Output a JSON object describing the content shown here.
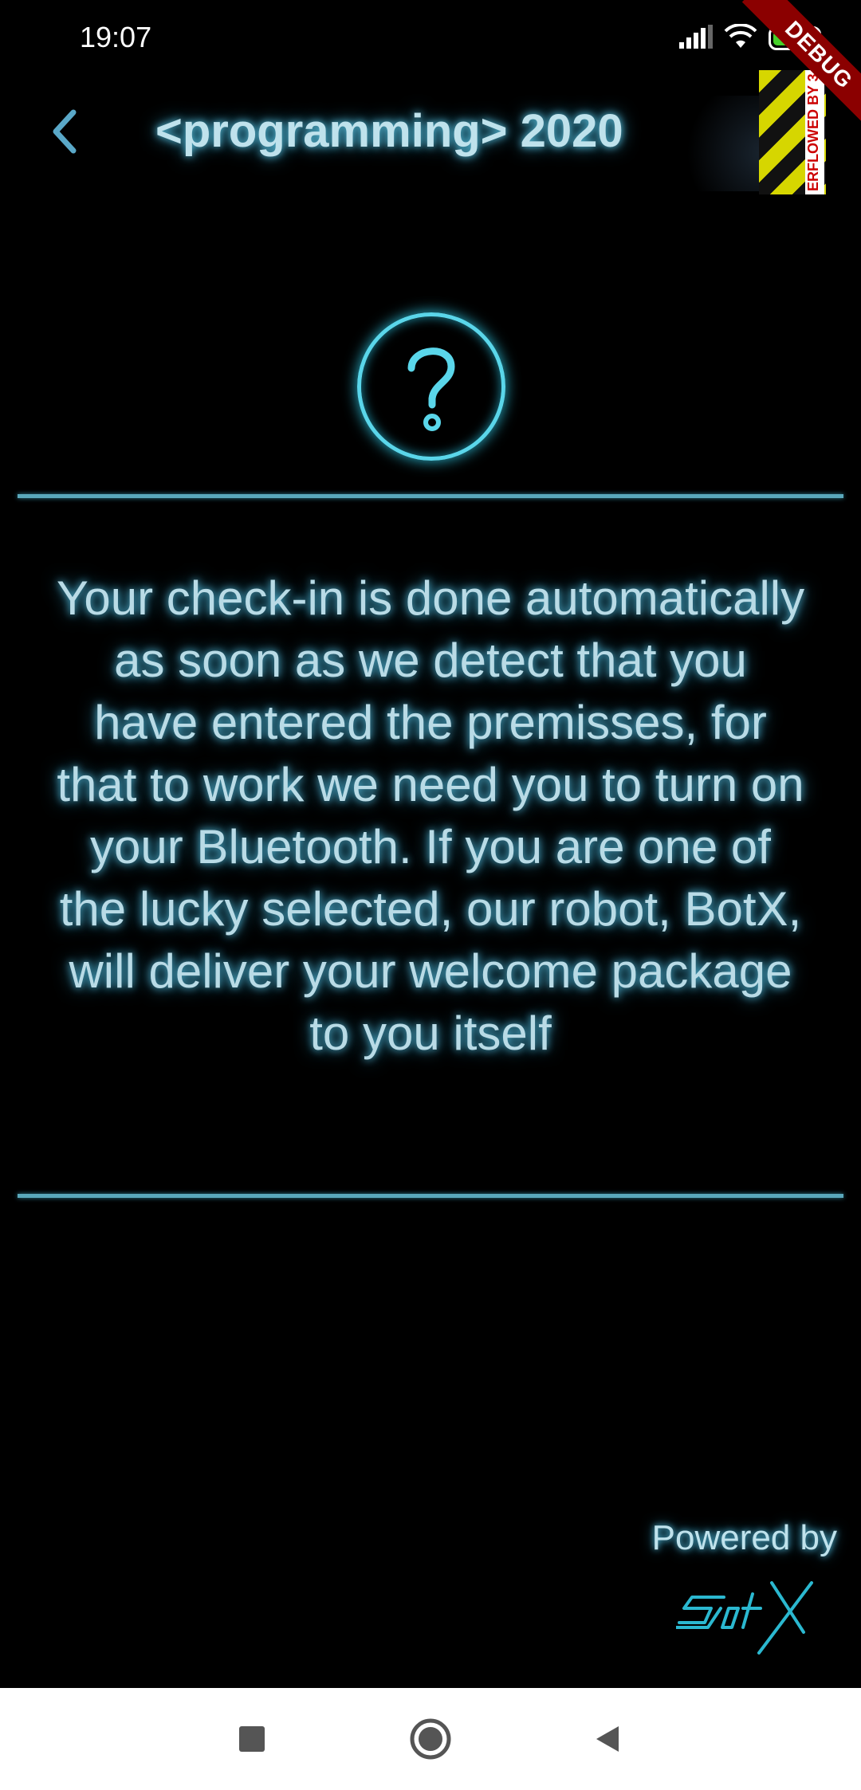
{
  "status_bar": {
    "time": "19:07",
    "battery_level": "77",
    "icons": [
      "signal-icon",
      "wifi-icon",
      "battery-icon"
    ]
  },
  "debug_banner": {
    "label": "DEBUG",
    "overflow_label": "ERFLOWED BY 3"
  },
  "app_bar": {
    "back_icon": "chevron-left-icon",
    "title": "<programming> 2020"
  },
  "main": {
    "help_icon": "question-circle-icon",
    "message": "Your check-in is done automatically as soon as we detect that you have entered the premisses, for that to work we need you to turn on your Bluetooth. If you are one of the lucky selected, our robot, BotX, will deliver your welcome package to you itself"
  },
  "footer": {
    "powered_by": "Powered by",
    "logo_text": "BotX"
  },
  "nav_bar": {
    "icons": [
      "recents-icon",
      "home-icon",
      "back-icon"
    ]
  },
  "colors": {
    "background": "#000000",
    "glow_accent": "#5ad6ea",
    "text": "#b9dbe6",
    "divider": "#5aa8bb",
    "battery": "#46d12a",
    "debug_banner": "#8b0000"
  }
}
